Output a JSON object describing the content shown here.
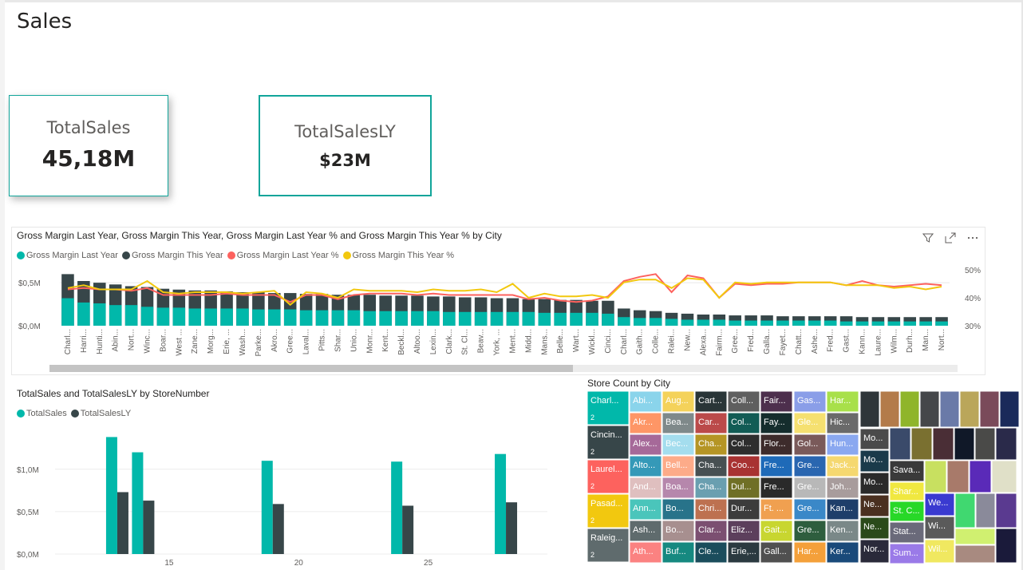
{
  "page": {
    "title": "Sales"
  },
  "cards": [
    {
      "title": "TotalSales",
      "value": "45,18M"
    },
    {
      "title": "TotalSalesLY",
      "value": "$23M"
    }
  ],
  "colors": {
    "teal": "#01b8aa",
    "dark": "#374649",
    "red": "#fd625e",
    "yellow": "#f2c80f",
    "card_border": "#11a59a"
  },
  "gross_margin_chart": {
    "title": "Gross Margin Last Year, Gross Margin This Year, Gross Margin Last Year % and Gross Margin This Year % by City",
    "legend": [
      {
        "label": "Gross Margin Last Year",
        "color": "#01b8aa"
      },
      {
        "label": "Gross Margin This Year",
        "color": "#374649"
      },
      {
        "label": "Gross Margin Last Year %",
        "color": "#fd625e"
      },
      {
        "label": "Gross Margin This Year %",
        "color": "#f2c80f"
      }
    ],
    "header_icons": [
      "filter-icon",
      "focus-mode-icon",
      "more-options-icon"
    ]
  },
  "sales_chart": {
    "title": "TotalSales and TotalSalesLY by StoreNumber",
    "legend": [
      {
        "label": "TotalSales",
        "color": "#01b8aa"
      },
      {
        "label": "TotalSalesLY",
        "color": "#374649"
      }
    ]
  },
  "store_count_chart": {
    "title": "Store Count by City"
  },
  "chart_data": [
    {
      "type": "bar",
      "subtype": "stacked column with lines",
      "title": "Gross Margin Last Year, Gross Margin This Year, Gross Margin Last Year % and Gross Margin This Year % by City",
      "categories": [
        "Charl...",
        "Harri...",
        "Hunti...",
        "Abin...",
        "Nort...",
        "Winc...",
        "Boar...",
        "West ...",
        "Zane...",
        "Morg...",
        "Erie, ...",
        "Wash...",
        "Parke...",
        "Akro...",
        "Gree...",
        "Laval...",
        "Pitts...",
        "Shar...",
        "Unio...",
        "Monr...",
        "Kent...",
        "Beckl...",
        "Altoo...",
        "Lexin...",
        "Clark...",
        "St. Cl...",
        "Beav...",
        "York, ...",
        "Ment...",
        "Midd...",
        "Mans...",
        "Belle...",
        "Wart...",
        "Wickl...",
        "Cinci...",
        "Charl...",
        "Gaith...",
        "Colle...",
        "Ralei...",
        "New...",
        "Alexa...",
        "Fairm...",
        "Gree...",
        "Fred...",
        "Galla...",
        "Fayet...",
        "Chatt...",
        "Ashe...",
        "Fred...",
        "Gast...",
        "Kann...",
        "Laure...",
        "Wilm...",
        "Durh...",
        "Man...",
        "Nort..."
      ],
      "series": [
        {
          "name": "Gross Margin Last Year",
          "axis": "left",
          "values": [
            0.32,
            0.27,
            0.26,
            0.24,
            0.24,
            0.22,
            0.21,
            0.21,
            0.2,
            0.2,
            0.2,
            0.2,
            0.19,
            0.19,
            0.19,
            0.18,
            0.18,
            0.18,
            0.18,
            0.17,
            0.17,
            0.17,
            0.17,
            0.17,
            0.16,
            0.16,
            0.16,
            0.16,
            0.16,
            0.16,
            0.15,
            0.15,
            0.15,
            0.15,
            0.14,
            0.1,
            0.09,
            0.09,
            0.08,
            0.07,
            0.07,
            0.07,
            0.06,
            0.06,
            0.06,
            0.06,
            0.06,
            0.06,
            0.06,
            0.05,
            0.05,
            0.05,
            0.05,
            0.05,
            0.05,
            0.05
          ]
        },
        {
          "name": "Gross Margin This Year",
          "axis": "left",
          "values": [
            0.6,
            0.52,
            0.5,
            0.48,
            0.46,
            0.45,
            0.43,
            0.42,
            0.41,
            0.41,
            0.4,
            0.39,
            0.39,
            0.38,
            0.38,
            0.37,
            0.37,
            0.36,
            0.36,
            0.36,
            0.35,
            0.35,
            0.35,
            0.34,
            0.34,
            0.33,
            0.33,
            0.32,
            0.32,
            0.31,
            0.31,
            0.3,
            0.3,
            0.29,
            0.29,
            0.2,
            0.18,
            0.17,
            0.15,
            0.14,
            0.13,
            0.13,
            0.12,
            0.12,
            0.12,
            0.11,
            0.11,
            0.11,
            0.11,
            0.11,
            0.1,
            0.1,
            0.1,
            0.1,
            0.1,
            0.1
          ]
        },
        {
          "name": "Gross Margin Last Year %",
          "axis": "right",
          "values": [
            0.43,
            0.435,
            0.43,
            0.43,
            0.425,
            0.435,
            0.41,
            0.41,
            0.41,
            0.41,
            0.415,
            0.41,
            0.41,
            0.41,
            0.385,
            0.41,
            0.41,
            0.395,
            0.41,
            0.415,
            0.415,
            0.415,
            0.41,
            0.415,
            0.41,
            0.41,
            0.41,
            0.41,
            0.41,
            0.395,
            0.4,
            0.39,
            0.385,
            0.39,
            0.405,
            0.46,
            0.475,
            0.485,
            0.42,
            0.48,
            0.47,
            0.4,
            0.45,
            0.445,
            0.45,
            0.45,
            0.455,
            0.455,
            0.455,
            0.445,
            0.46,
            0.445,
            0.44,
            0.445,
            0.45,
            0.445
          ]
        },
        {
          "name": "Gross Margin This Year %",
          "axis": "right",
          "values": [
            0.435,
            0.445,
            0.43,
            0.43,
            0.43,
            0.46,
            0.42,
            0.415,
            0.42,
            0.42,
            0.42,
            0.415,
            0.42,
            0.425,
            0.375,
            0.42,
            0.415,
            0.4,
            0.43,
            0.425,
            0.425,
            0.425,
            0.42,
            0.43,
            0.425,
            0.425,
            0.43,
            0.42,
            0.45,
            0.4,
            0.415,
            0.405,
            0.405,
            0.41,
            0.4,
            0.455,
            0.465,
            0.465,
            0.435,
            0.47,
            0.465,
            0.4,
            0.455,
            0.45,
            0.455,
            0.455,
            0.455,
            0.455,
            0.455,
            0.445,
            0.445,
            0.445,
            0.435,
            0.44,
            0.43,
            0.44
          ]
        }
      ],
      "y_left": {
        "ticks": [
          "$0,0M",
          "$0,5M"
        ],
        "ylim": [
          0,
          0.65
        ]
      },
      "y_right": {
        "ticks": [
          "30%",
          "40%",
          "50%"
        ],
        "ylim": [
          0.3,
          0.5
        ]
      },
      "legend_position": "top-left",
      "grid": true
    },
    {
      "type": "bar",
      "title": "TotalSales and TotalSalesLY by StoreNumber",
      "x": [
        13,
        14,
        19,
        24,
        28
      ],
      "x_ticks": [
        "15",
        "20",
        "25"
      ],
      "xlim": [
        10.6,
        29.6
      ],
      "series": [
        {
          "name": "TotalSales",
          "values": [
            1.38,
            1.2,
            1.1,
            1.09,
            1.18
          ]
        },
        {
          "name": "TotalSalesLY",
          "values": [
            0.73,
            0.63,
            0.59,
            0.57,
            0.61
          ]
        }
      ],
      "y_ticks": [
        "$0,0M",
        "$0,5M",
        "$1,0M"
      ],
      "ylim": [
        0,
        1.45
      ],
      "legend_position": "top-left",
      "grid": true
    },
    {
      "type": "treemap",
      "title": "Store Count by City",
      "labeled_cells": [
        {
          "label": "Charl...",
          "count": "2",
          "color": "#01b8aa"
        },
        {
          "label": "Cincin...",
          "count": "2",
          "color": "#374649"
        },
        {
          "label": "Laurel...",
          "count": "2",
          "color": "#fd625e"
        },
        {
          "label": "Pasad...",
          "count": "2",
          "color": "#f2c80f"
        },
        {
          "label": "Raleig...",
          "count": "2",
          "color": "#5f6b6d"
        },
        {
          "label": "Abi...",
          "color": "#8ad4eb"
        },
        {
          "label": "Akr...",
          "color": "#fe9666"
        },
        {
          "label": "Alex...",
          "color": "#a66999"
        },
        {
          "label": "Alto...",
          "color": "#3599b8"
        },
        {
          "label": "And...",
          "color": "#dfbfbf"
        },
        {
          "label": "Ann...",
          "color": "#4ac5bb"
        },
        {
          "label": "Ash...",
          "color": "#5f6b6d"
        },
        {
          "label": "Ath...",
          "color": "#fb8281"
        },
        {
          "label": "Aug...",
          "color": "#f4d25a"
        },
        {
          "label": "Bea...",
          "color": "#7f898a"
        },
        {
          "label": "Bec...",
          "color": "#a4ddee"
        },
        {
          "label": "Bell...",
          "color": "#fdab89"
        },
        {
          "label": "Boa...",
          "color": "#b687ac"
        },
        {
          "label": "Bo...",
          "color": "#28738a"
        },
        {
          "label": "Bo...",
          "color": "#a78f8f"
        },
        {
          "label": "Buf...",
          "color": "#168980"
        },
        {
          "label": "Cart...",
          "color": "#293537"
        },
        {
          "label": "Car...",
          "color": "#bb4a4a"
        },
        {
          "label": "Cha...",
          "color": "#b59525"
        },
        {
          "label": "Cha...",
          "color": "#475052"
        },
        {
          "label": "Cha...",
          "color": "#6a9fb0"
        },
        {
          "label": "Chri...",
          "color": "#bd7150"
        },
        {
          "label": "Clar...",
          "color": "#7b4f71"
        },
        {
          "label": "Cle...",
          "color": "#1b4d5c"
        },
        {
          "label": "Coll...",
          "color": "#5f5f5f"
        },
        {
          "label": "Col...",
          "color": "#125c55"
        },
        {
          "label": "Col...",
          "color": "#2e2e2e"
        },
        {
          "label": "Coo...",
          "color": "#a83232"
        },
        {
          "label": "Dul...",
          "color": "#6f6f26"
        },
        {
          "label": "Dur...",
          "color": "#3c3c3c"
        },
        {
          "label": "Eliz...",
          "color": "#5c3f5c"
        },
        {
          "label": "Erie,...",
          "color": "#2b3a40"
        },
        {
          "label": "Fair...",
          "color": "#4d2f4d"
        },
        {
          "label": "Fay...",
          "color": "#152d2d"
        },
        {
          "label": "Flor...",
          "color": "#3d2b2b"
        },
        {
          "label": "Fre...",
          "color": "#1e6ab8"
        },
        {
          "label": "Fre...",
          "color": "#2a2a2a"
        },
        {
          "label": "Ft. ...",
          "color": "#f0a050"
        },
        {
          "label": "Gait...",
          "color": "#c8d630"
        },
        {
          "label": "Gall...",
          "color": "#505050"
        },
        {
          "label": "Gas...",
          "color": "#8a9ee8"
        },
        {
          "label": "Gle...",
          "color": "#f5e070"
        },
        {
          "label": "Gol...",
          "color": "#7a5a5a"
        },
        {
          "label": "Gre...",
          "color": "#2a66b0"
        },
        {
          "label": "Gre...",
          "color": "#b8b8b8"
        },
        {
          "label": "Gre...",
          "color": "#3a88c8"
        },
        {
          "label": "Gre...",
          "color": "#2e5e3e"
        },
        {
          "label": "Har...",
          "color": "#f4a03a"
        },
        {
          "label": "Har...",
          "color": "#a8e04a"
        },
        {
          "label": "Hic...",
          "color": "#6a6a6a"
        },
        {
          "label": "Hun...",
          "color": "#8aa8f0"
        },
        {
          "label": "Jack...",
          "color": "#f5d870"
        },
        {
          "label": "Joh...",
          "color": "#a89c9c"
        },
        {
          "label": "Kan...",
          "color": "#1e3e6a"
        },
        {
          "label": "Ken...",
          "color": "#7a8888"
        },
        {
          "label": "Ker...",
          "color": "#1a4a7a"
        },
        {
          "label": "Mo...",
          "color": "#4a4a4a"
        },
        {
          "label": "Mo...",
          "color": "#1a3a4a"
        },
        {
          "label": "Mo...",
          "color": "#2a2a2a"
        },
        {
          "label": "Ne...",
          "color": "#4a3020"
        },
        {
          "label": "Ne...",
          "color": "#2a4a1a"
        },
        {
          "label": "Nor...",
          "color": "#2a2a3a"
        },
        {
          "label": "Sava...",
          "color": "#3a3a3a"
        },
        {
          "label": "Shar...",
          "color": "#f0e840"
        },
        {
          "label": "St. C...",
          "color": "#28d828"
        },
        {
          "label": "Stat...",
          "color": "#6a6a7a"
        },
        {
          "label": "Sum...",
          "color": "#9a7ae8"
        },
        {
          "label": "We...",
          "color": "#3a3ad0"
        },
        {
          "label": "Wi...",
          "color": "#5a5a5a"
        },
        {
          "label": "Wil...",
          "color": "#f0e860"
        }
      ],
      "unlabeled_cell_colors": [
        "#2f363a",
        "#b37b4a",
        "#8fb52a",
        "#45474a",
        "#6a7aa8",
        "#baa65a",
        "#7a4a5a",
        "#1a2a5a",
        "#3a4a6a",
        "#7a7030",
        "#4a2e36",
        "#101828",
        "#4a4a48",
        "#2a2a4a",
        "#c8e060",
        "#a87a6a",
        "#5a2ab8",
        "#e0e0c8",
        "#40d870",
        "#8a8a9a",
        "#5a3a90",
        "#d0f070",
        "#a88a80",
        "#1a1a3a"
      ]
    }
  ]
}
